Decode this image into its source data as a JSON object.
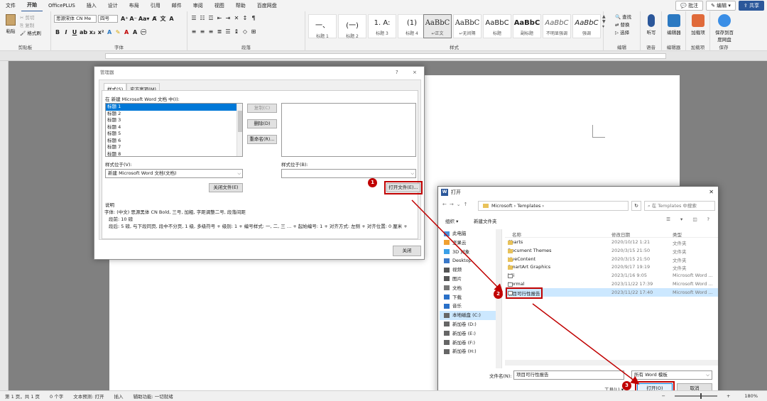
{
  "menu": {
    "items": [
      "文件",
      "开始",
      "OfficePLUS",
      "插入",
      "设计",
      "布局",
      "引用",
      "邮件",
      "审阅",
      "视图",
      "帮助",
      "百度网盘"
    ],
    "comment_btn": "批注",
    "edit_btn": "编辑",
    "share_btn": "共享"
  },
  "ribbon": {
    "paste": "粘贴",
    "cut": "剪切",
    "copy": "复制",
    "format_painter": "格式刷",
    "clipboard_label": "剪贴板",
    "font_name": "思源宋体 CN Me",
    "font_size": "四号",
    "font_label": "字体",
    "paragraph_label": "段落",
    "styles_label": "样式",
    "styles": [
      {
        "preview": "一、",
        "name": "标题 1"
      },
      {
        "preview": "(一)",
        "name": "标题 2"
      },
      {
        "preview": "1. A:",
        "name": "标题 3"
      },
      {
        "preview": "(1)",
        "name": "标题 4"
      },
      {
        "preview": "AaBbC",
        "name": "↵正文"
      },
      {
        "preview": "AaBbC",
        "name": "↵无间隔"
      },
      {
        "preview": "AaBbC",
        "name": "标题"
      },
      {
        "preview": "AaBbC",
        "name": "副标题"
      },
      {
        "preview": "AaBbC",
        "name": "不明显强调"
      },
      {
        "preview": "AaBbC",
        "name": "强调"
      }
    ],
    "find": "查找",
    "replace": "替换",
    "select": "选择",
    "editing_label": "编辑",
    "dictate": "听写",
    "voice_label": "语音",
    "editor": "编辑器",
    "editor_label": "编辑器",
    "addins": "加载项",
    "addins_label": "加载项",
    "save_baidu": "保存到百度网盘",
    "save_label": "保存"
  },
  "organizer": {
    "title": "管理器",
    "help": "?",
    "close_x": "×",
    "tab_styles": "样式(S)",
    "tab_macros": "宏方案项(M)",
    "in_label": "在 新建 Microsoft Word 文档 中(I):",
    "list": [
      "标题 1",
      "标题 2",
      "标题 3",
      "标题 4",
      "标题 5",
      "标题 6",
      "标题 7",
      "标题 8"
    ],
    "copy_btn": "复制(C)",
    "delete_btn": "删除(D)",
    "rename_btn": "重命名(R)...",
    "left_avail_label": "样式位于(V):",
    "left_avail_value": "新建 Microsoft Word 文档(文档)",
    "right_avail_label": "样式位于(B):",
    "close_file_btn": "关闭文件(E)",
    "open_file_btn": "打开文件(E)...",
    "desc_label": "说明",
    "desc_line1": "字体: (中文) 思源黑体 CN Bold, 三号, 加粗, 字距调整二号, 段落间距",
    "desc_line2": "段前: 10 磅",
    "desc_line3": "段后: 5 磅, 与下段同页, 段中不分页, 1 级, 多级符号 + 级别: 1 + 编号样式: 一, 二, 三 … + 起始编号: 1 + 对齐方式: 左侧 + 对齐位置: 0 厘米 +",
    "close_btn": "关闭"
  },
  "open_dialog": {
    "title": "打开",
    "close_x": "✕",
    "address": "Microsoft › Templates ›",
    "search_placeholder": "在 Templates 中搜索",
    "organize": "组织 ▾",
    "new_folder": "新建文件夹",
    "view_icons": "☰ ▾ ◫ ?",
    "col_name": "名称",
    "col_date": "修改日期",
    "col_type": "类型",
    "tree": [
      {
        "name": "此电脑",
        "color": "#4a90d9"
      },
      {
        "name": "坚果云",
        "color": "#f0a030"
      },
      {
        "name": "3D 对象",
        "color": "#3aa0e8"
      },
      {
        "name": "Desktop",
        "color": "#3a78c8"
      },
      {
        "name": "视频",
        "color": "#555555"
      },
      {
        "name": "图片",
        "color": "#555555"
      },
      {
        "name": "文档",
        "color": "#777777"
      },
      {
        "name": "下载",
        "color": "#2a70c8"
      },
      {
        "name": "音乐",
        "color": "#2a70c8"
      },
      {
        "name": "本地磁盘 (C:)",
        "color": "#666666"
      },
      {
        "name": "新加卷 (D:)",
        "color": "#666666"
      },
      {
        "name": "新加卷 (E:)",
        "color": "#666666"
      },
      {
        "name": "新加卷 (F:)",
        "color": "#666666"
      },
      {
        "name": "新加卷 (H:)",
        "color": "#666666"
      }
    ],
    "files": [
      {
        "name": "Charts",
        "date": "2020/10/12 1:21",
        "type": "文件夹",
        "kind": "folder"
      },
      {
        "name": "Document Themes",
        "date": "2020/3/15 21:50",
        "type": "文件夹",
        "kind": "folder"
      },
      {
        "name": "LiveContent",
        "date": "2020/3/15 21:50",
        "type": "文件夹",
        "kind": "folder"
      },
      {
        "name": "SmartArt Graphics",
        "date": "2020/9/17 19:19",
        "type": "文件夹",
        "kind": "folder"
      },
      {
        "name": "biji",
        "date": "2023/1/16 9:05",
        "type": "Microsoft Word ...",
        "kind": "doc"
      },
      {
        "name": "Normal",
        "date": "2023/11/22 17:39",
        "type": "Microsoft Word ...",
        "kind": "doc"
      },
      {
        "name": "项目可行性报告",
        "date": "2023/11/22 17:40",
        "type": "Microsoft Word ...",
        "kind": "doc"
      }
    ],
    "filename_label": "文件名(N):",
    "filename_value": "项目可行性报告",
    "filetype_value": "所有 Word 模板",
    "tools": "工具(L) ▾",
    "open_btn": "打开(O)",
    "cancel_btn": "取消"
  },
  "badges": [
    "1",
    "2",
    "3"
  ],
  "status": {
    "page": "第 1 页，共 1 页",
    "words": "0 个字",
    "predict": "文本预测: 打开",
    "insert": "插入",
    "accessibility": "辅助功能: 一切就绪",
    "zoom": "180%"
  },
  "colors": {
    "annotation": "#c00000",
    "accent": "#2b579a",
    "selection": "#0078d7"
  }
}
